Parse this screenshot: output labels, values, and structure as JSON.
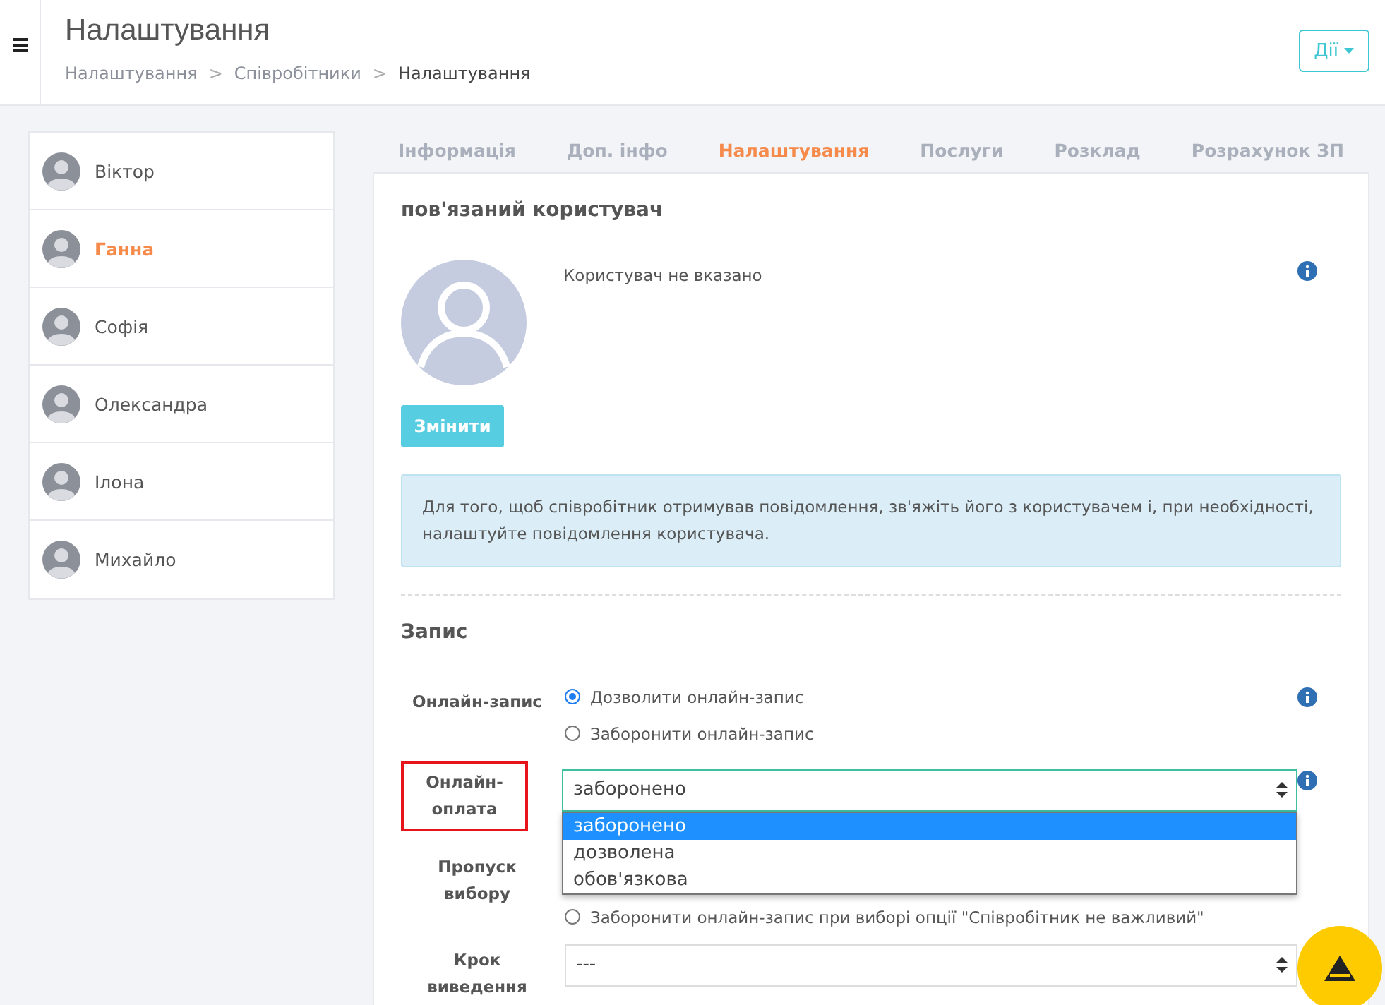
{
  "header": {
    "title": "Налаштування",
    "breadcrumbs": [
      {
        "label": "Налаштування",
        "current": false
      },
      {
        "label": "Співробітники",
        "current": false
      },
      {
        "label": "Налаштування",
        "current": true
      }
    ],
    "breadcrumb_separator": ">",
    "actions_button": "Дії"
  },
  "employees": [
    {
      "name": "Віктор",
      "selected": false
    },
    {
      "name": "Ганна",
      "selected": true
    },
    {
      "name": "Софія",
      "selected": false
    },
    {
      "name": "Олександра",
      "selected": false
    },
    {
      "name": "Ілона",
      "selected": false
    },
    {
      "name": "Михайло",
      "selected": false
    }
  ],
  "tabs": [
    {
      "label": "Інформація",
      "selected": false
    },
    {
      "label": "Доп. інфо",
      "selected": false
    },
    {
      "label": "Налаштування",
      "selected": true
    },
    {
      "label": "Послуги",
      "selected": false
    },
    {
      "label": "Розклад",
      "selected": false
    },
    {
      "label": "Розрахунок ЗП",
      "selected": false
    }
  ],
  "linked_user": {
    "heading": "пов'язаний користувач",
    "status": "Користувач не вказано",
    "change_button": "Змінити",
    "notice": "Для того, щоб співробітник отримував повідомлення, зв'яжіть його з користувачем і, при необхідності, налаштуйте повідомлення користувача."
  },
  "booking": {
    "heading": "Запис",
    "online_booking": {
      "label": "Онлайн-запис",
      "options": [
        {
          "label": "Дозволити онлайн-запис",
          "selected": true
        },
        {
          "label": "Заборонити онлайн-запис",
          "selected": false
        }
      ]
    },
    "online_payment": {
      "label": "Онлайн-оплата",
      "highlighted": true,
      "value": "заборонено",
      "options": [
        {
          "label": "заборонено",
          "selected": true
        },
        {
          "label": "дозволена",
          "selected": false
        },
        {
          "label": "обов'язкова",
          "selected": false
        }
      ]
    },
    "skip_choice": {
      "label": "Пропуск вибору",
      "option": {
        "label": "Заборонити онлайн-запис при виборі опції \"Співробітник не важливий\"",
        "selected": false
      }
    },
    "step": {
      "label": "Крок виведення",
      "value": "---"
    }
  }
}
